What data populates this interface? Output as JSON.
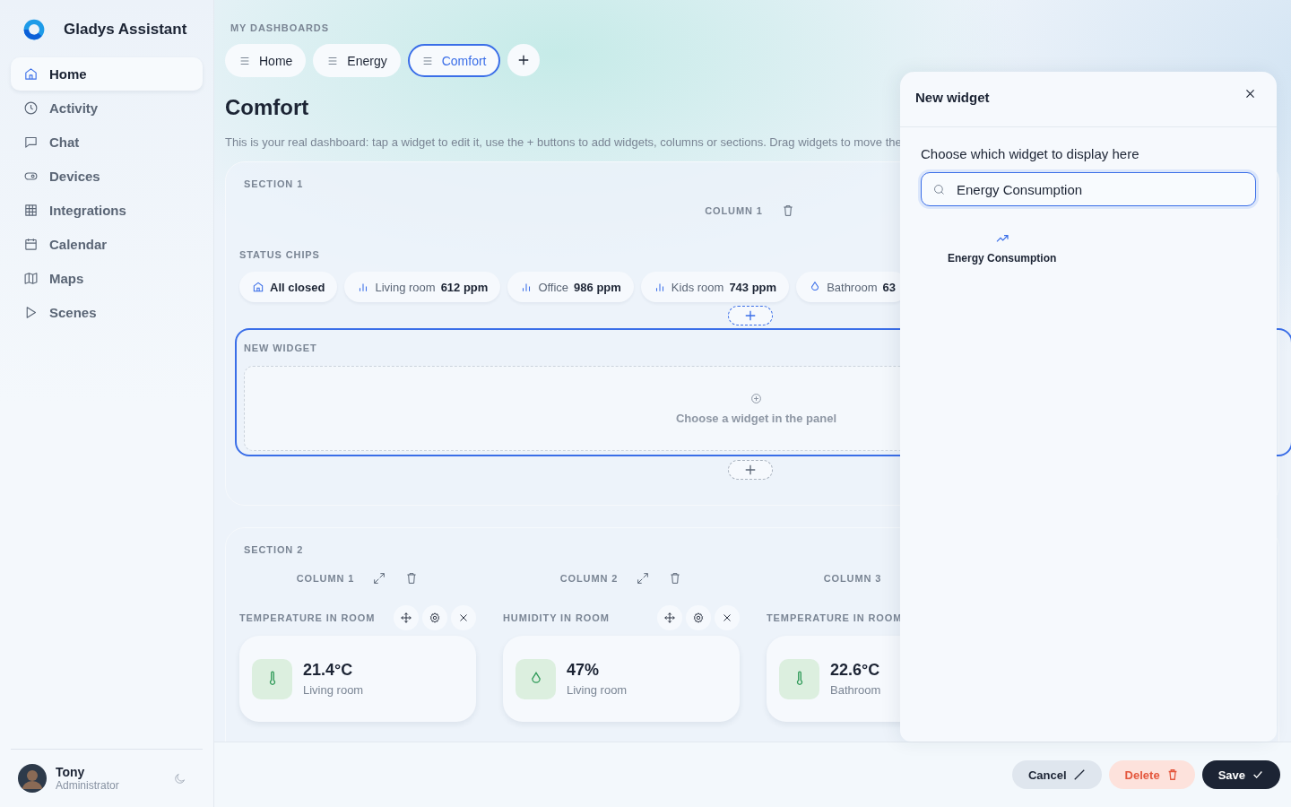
{
  "app": {
    "name": "Gladys Assistant"
  },
  "sidebar": {
    "items": [
      {
        "label": "Home",
        "selected": true
      },
      {
        "label": "Activity",
        "selected": false
      },
      {
        "label": "Chat",
        "selected": false
      },
      {
        "label": "Devices",
        "selected": false
      },
      {
        "label": "Integrations",
        "selected": false
      },
      {
        "label": "Calendar",
        "selected": false
      },
      {
        "label": "Maps",
        "selected": false
      },
      {
        "label": "Scenes",
        "selected": false
      }
    ],
    "user": {
      "name": "Tony",
      "role": "Administrator"
    }
  },
  "dashboards": {
    "label": "MY DASHBOARDS",
    "tabs": [
      {
        "label": "Home",
        "selected": false
      },
      {
        "label": "Energy",
        "selected": false
      },
      {
        "label": "Comfort",
        "selected": true
      }
    ]
  },
  "page": {
    "title": "Comfort",
    "description": "This is your real dashboard: tap a widget to edit it, use the + buttons to add widgets, columns or sections. Drag widgets to move the"
  },
  "section_1": {
    "title": "SECTION 1",
    "column": "COLUMN 1",
    "chips_title": "STATUS CHIPS",
    "chips": [
      {
        "kind": "home",
        "label": "All closed"
      },
      {
        "kind": "co2",
        "label": "Living room",
        "value": "612 ppm"
      },
      {
        "kind": "co2",
        "label": "Office",
        "value": "986 ppm"
      },
      {
        "kind": "co2",
        "label": "Kids room",
        "value": "743 ppm"
      },
      {
        "kind": "humidity",
        "label": "Bathroom",
        "value": "63"
      }
    ],
    "new_widget": {
      "title": "NEW WIDGET",
      "hint": "Choose a widget in the panel"
    }
  },
  "section_2": {
    "title": "SECTION 2",
    "columns": [
      {
        "title": "COLUMN 1",
        "widget": {
          "title": "TEMPERATURE IN ROOM",
          "kind": "temperature",
          "value": "21.4°C",
          "room": "Living room",
          "actions": true
        }
      },
      {
        "title": "COLUMN 2",
        "widget": {
          "title": "HUMIDITY IN ROOM",
          "kind": "humidity",
          "value": "47%",
          "room": "Living room",
          "actions": true
        }
      },
      {
        "title": "COLUMN 3",
        "widget": {
          "title": "TEMPERATURE IN ROOM",
          "kind": "temperature",
          "value": "22.6°C",
          "room": "Bathroom",
          "actions": false
        }
      }
    ]
  },
  "panel": {
    "title": "New widget",
    "prompt": "Choose which widget to display here",
    "search": "Energy Consumption",
    "results": [
      {
        "label": "Energy Consumption"
      }
    ]
  },
  "footer": {
    "buttons": [
      {
        "kind": "cancel",
        "label": "Cancel"
      },
      {
        "kind": "delete",
        "label": "Delete"
      },
      {
        "kind": "save",
        "label": "Save"
      }
    ]
  }
}
